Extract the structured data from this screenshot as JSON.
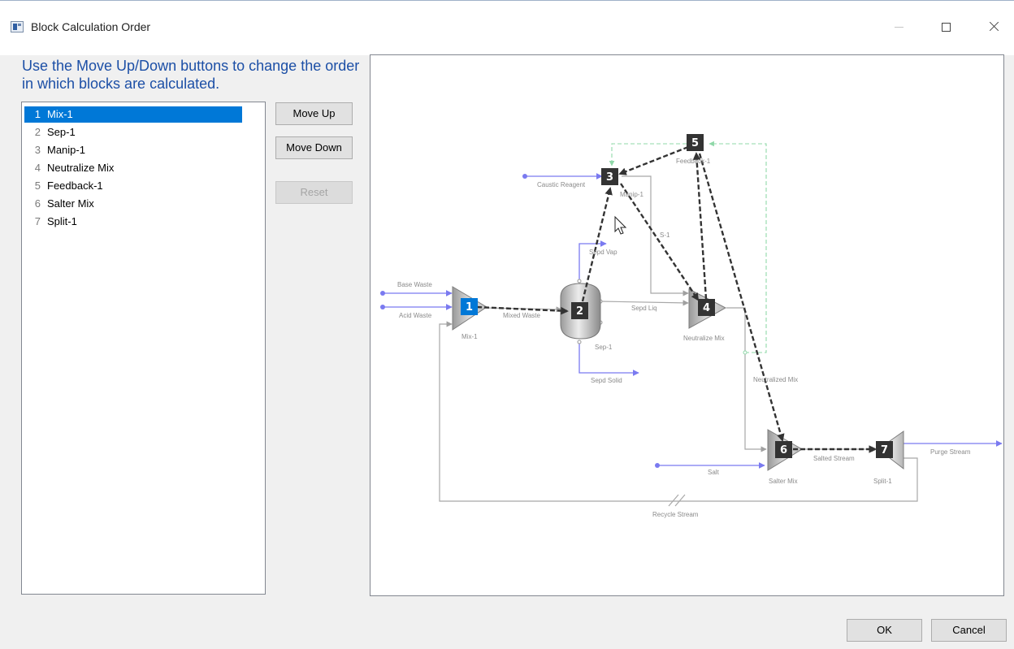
{
  "window": {
    "title": "Block Calculation Order",
    "icon": "app-window-icon",
    "buttons": [
      "minimize-icon",
      "maximize-icon",
      "close-icon"
    ]
  },
  "instructions": "Use the Move Up/Down buttons to change the order in which blocks are calculated.",
  "blocks": [
    {
      "num": "1",
      "name": "Mix-1",
      "selected": true
    },
    {
      "num": "2",
      "name": "Sep-1",
      "selected": false
    },
    {
      "num": "3",
      "name": "Manip-1",
      "selected": false
    },
    {
      "num": "4",
      "name": "Neutralize Mix",
      "selected": false
    },
    {
      "num": "5",
      "name": "Feedback-1",
      "selected": false
    },
    {
      "num": "6",
      "name": "Salter Mix",
      "selected": false
    },
    {
      "num": "7",
      "name": "Split-1",
      "selected": false
    }
  ],
  "buttons": {
    "move_up": "Move Up",
    "move_down": "Move Down",
    "reset": "Reset",
    "ok": "OK",
    "cancel": "Cancel"
  },
  "diagram": {
    "block_labels": {
      "mix": "Mix-1",
      "sep": "Sep-1",
      "manip": "Manip-1",
      "neutralize": "Neutralize Mix",
      "feedback": "Feedback-1",
      "salter": "Salter Mix",
      "split": "Split-1"
    },
    "stream_labels": {
      "base_waste": "Base Waste",
      "acid_waste": "Acid Waste",
      "mixed_waste": "Mixed Waste",
      "caustic_reagent": "Caustic Reagent",
      "sepd_vap": "Sepd Vap",
      "sepd_liq": "Sepd Liq",
      "sepd_solid": "Sepd Solid",
      "s1": "S-1",
      "neutralized_mix": "Neutralized Mix",
      "salt": "Salt",
      "salted_stream": "Salted Stream",
      "purge_stream": "Purge Stream",
      "recycle_stream": "Recycle Stream"
    },
    "colors": {
      "feed_stream": "#7a7af0",
      "internal_stream": "#a8a8a8",
      "feedback_stream": "#8fd8a8",
      "order_arrow": "#333333",
      "badge": "#333333",
      "badge_selected": "#0078d7"
    }
  }
}
